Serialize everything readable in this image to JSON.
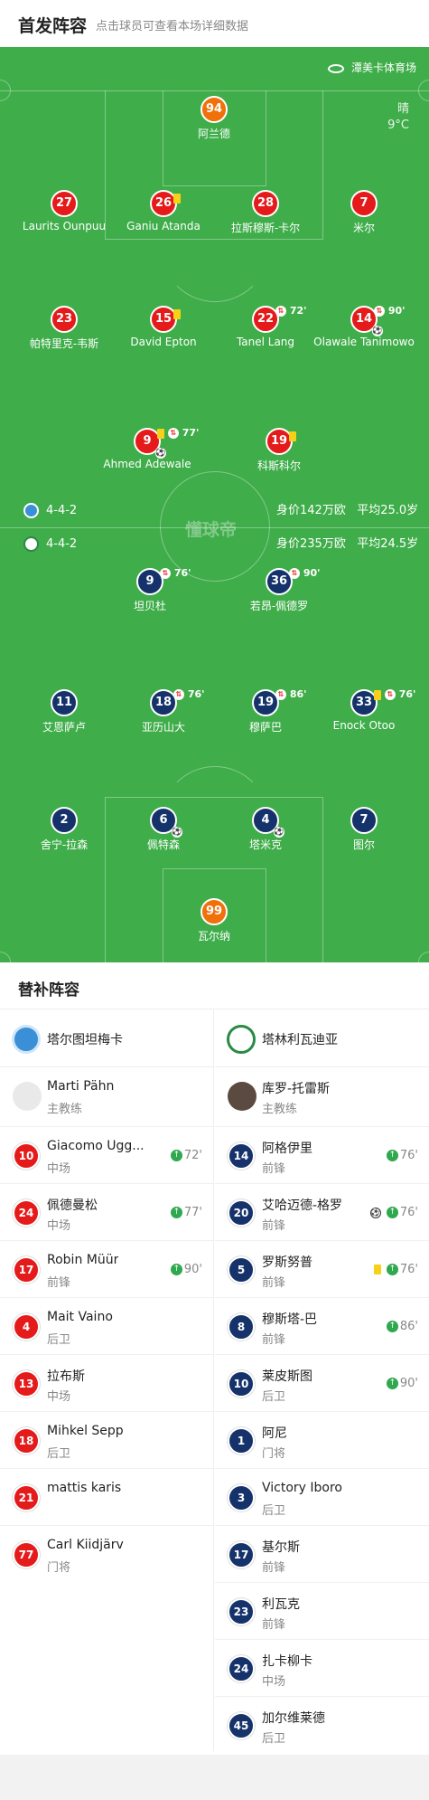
{
  "header": {
    "title": "首发阵容",
    "subtitle": "点击球员可查看本场详细数据"
  },
  "pitch": {
    "venue": "潭美卡体育场",
    "weather": {
      "condition": "晴",
      "temp": "9°C"
    },
    "watermark": "懂球帝",
    "home_formation": {
      "formation": "4-4-2",
      "value": "身价142万欧",
      "age": "平均25.0岁"
    },
    "away_formation": {
      "formation": "4-4-2",
      "value": "身价235万欧",
      "age": "平均24.5岁"
    },
    "home_players": [
      {
        "num": "94",
        "name": "阿兰德",
        "gk": true
      },
      {
        "num": "27",
        "name": "Laurits Ounpuu"
      },
      {
        "num": "26",
        "name": "Ganiu Atanda",
        "card": "yellow"
      },
      {
        "num": "28",
        "name": "拉斯穆斯-卡尔",
        "card": ""
      },
      {
        "num": "7",
        "name": "米尔"
      },
      {
        "num": "23",
        "name": "帕特里克-韦斯"
      },
      {
        "num": "15",
        "name": "David Epton",
        "card": "yellow"
      },
      {
        "num": "22",
        "name": "Tanel Lang",
        "sub_min": "72'"
      },
      {
        "num": "14",
        "name": "Olawale Tanimowo",
        "sub_min": "90'",
        "goal": true
      },
      {
        "num": "9",
        "name": "Ahmed Adewale",
        "card": "yellow",
        "sub_min": "77'",
        "goal": true
      },
      {
        "num": "19",
        "name": "科斯科尔",
        "card": "yellow"
      }
    ],
    "away_players": [
      {
        "num": "9",
        "name": "坦贝杜",
        "sub_min": "76'"
      },
      {
        "num": "36",
        "name": "若昂-佩德罗",
        "sub_min": "90'"
      },
      {
        "num": "11",
        "name": "艾恩萨卢"
      },
      {
        "num": "18",
        "name": "亚历山大",
        "sub_min": "76'"
      },
      {
        "num": "19",
        "name": "穆萨巴",
        "sub_min": "86'"
      },
      {
        "num": "33",
        "name": "Enock Otoo",
        "card": "yellow",
        "sub_min": "76'"
      },
      {
        "num": "2",
        "name": "舍宁-拉森"
      },
      {
        "num": "6",
        "name": "佩特森",
        "goal": true
      },
      {
        "num": "4",
        "name": "塔米克",
        "goal": true
      },
      {
        "num": "7",
        "name": "图尔"
      },
      {
        "num": "99",
        "name": "瓦尔纳",
        "gk": true
      }
    ]
  },
  "subs": {
    "title": "替补阵容",
    "home": {
      "team": "塔尔图坦梅卡",
      "coach": {
        "name": "Marti Pähn",
        "role": "主教练"
      },
      "players": [
        {
          "num": "10",
          "name": "Giacomo Ugg...",
          "pos": "中场",
          "sub": "72'"
        },
        {
          "num": "24",
          "name": "佩德曼松",
          "pos": "中场",
          "sub": "77'"
        },
        {
          "num": "17",
          "name": "Robin Müür",
          "pos": "前锋",
          "sub": "90'"
        },
        {
          "num": "4",
          "name": "Mait Vaino",
          "pos": "后卫",
          "sub": ""
        },
        {
          "num": "13",
          "name": "拉布斯",
          "pos": "中场",
          "sub": ""
        },
        {
          "num": "18",
          "name": "Mihkel Sepp",
          "pos": "后卫",
          "sub": ""
        },
        {
          "num": "21",
          "name": "mattis karis",
          "pos": "",
          "sub": ""
        },
        {
          "num": "77",
          "name": "Carl Kiidjärv",
          "pos": "门将",
          "sub": ""
        }
      ]
    },
    "away": {
      "team": "塔林利瓦迪亚",
      "coach": {
        "name": "库罗-托雷斯",
        "role": "主教练"
      },
      "players": [
        {
          "num": "14",
          "name": "阿格伊里",
          "pos": "前锋",
          "sub": "76'"
        },
        {
          "num": "20",
          "name": "艾哈迈德-格罗",
          "pos": "前锋",
          "sub": "76'",
          "goal": true
        },
        {
          "num": "5",
          "name": "罗斯努普",
          "pos": "前锋",
          "sub": "76'",
          "card": "yellow"
        },
        {
          "num": "8",
          "name": "穆斯塔-巴",
          "pos": "前锋",
          "sub": "86'"
        },
        {
          "num": "10",
          "name": "莱皮斯图",
          "pos": "后卫",
          "sub": "90'"
        },
        {
          "num": "1",
          "name": "阿尼",
          "pos": "门将",
          "sub": ""
        },
        {
          "num": "3",
          "name": "Victory Iboro",
          "pos": "后卫",
          "sub": ""
        },
        {
          "num": "17",
          "name": "基尔斯",
          "pos": "前锋",
          "sub": ""
        },
        {
          "num": "23",
          "name": "利瓦克",
          "pos": "前锋",
          "sub": ""
        },
        {
          "num": "24",
          "name": "扎卡柳卡",
          "pos": "中场",
          "sub": ""
        },
        {
          "num": "45",
          "name": "加尔维莱德",
          "pos": "后卫",
          "sub": ""
        }
      ]
    }
  },
  "colors": {
    "pitch": "#3fad4a",
    "home": "#e51a1a",
    "away": "#15336a",
    "gk": "#f0700a",
    "yellow_card": "#f7d117",
    "sub_in": "#2fa84f"
  },
  "icons": {
    "venue": "stadium-icon",
    "home_badge": "tartu-badge-icon",
    "away_badge": "levadia-badge-icon",
    "coach": "person-icon",
    "goal": "football-icon",
    "sub": "substitution-icon",
    "card": "yellow-card-icon"
  }
}
